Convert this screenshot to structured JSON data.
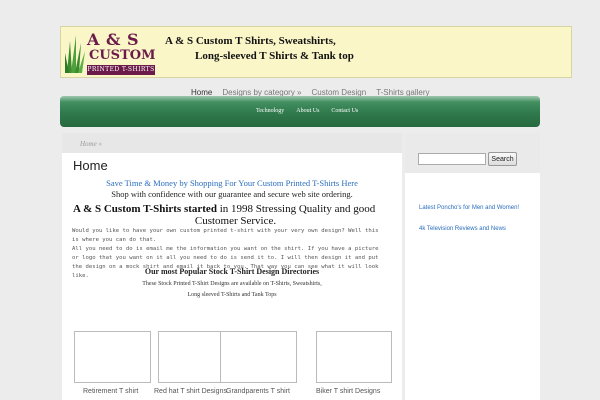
{
  "header": {
    "logo_main": "A & S",
    "logo_sub": "CUSTOM",
    "logo_bar": "PRINTED T-SHIRTS",
    "title_line1": "A & S Custom T Shirts, Sweatshirts,",
    "title_line2": "Long-sleeved T Shirts & Tank top"
  },
  "topnav": {
    "items": [
      "Home",
      "Designs by category »",
      "Custom Design",
      "T-Shirts gallery"
    ]
  },
  "subnav": {
    "items": [
      "Technology",
      "About Us",
      "Contact Us"
    ]
  },
  "main": {
    "breadcrumb": "Home »",
    "page_title": "Home",
    "save_line": "Save Time & Money by Shopping For Your Custom Printed T-Shirts Here",
    "ship_line": "Shop with confidence with our guarantee and secure web site ordering.",
    "started_bold": "A & S Custom T-Shirts started",
    "started_rest": " in 1998  Stressing Quality and good",
    "started_line2": "Customer Service.",
    "body_lines": [
      "Would you like to have your own custom printed t-shirt with your very own design? Well this",
      "is where you can do that.",
      "All you need to do is email me the information you want on the shirt. If you have a picture",
      "or logo that you want on it all you need to do is send it to. I will then design it and put",
      "the design on a mock shirt and email it back to you. That way you can see what it will look",
      "like."
    ],
    "directories_title": "Our most Popular Stock T-Shirt Design Directories",
    "dir_sub_line1": "These Stock Printed T-Shirt Designs are available on T-Shirts, Sweatshirts,",
    "dir_sub_line2": "Long sleeved T-Shirts and Tank Tops",
    "thumbs": [
      {
        "label": "Retirement T shirt"
      },
      {
        "label": "Red hat T shirt Designs"
      },
      {
        "label": "Grandparents T shirt"
      },
      {
        "label": "Biker T shirt Designs"
      }
    ]
  },
  "sidebar": {
    "search_placeholder": "",
    "search_button": "Search",
    "links": [
      "Latest Poncho's for Men and Women!",
      "4k Television Reviews and News"
    ]
  },
  "colors": {
    "accent_green": "#2f7a4c",
    "link_blue": "#2a6ebd",
    "logo_maroon": "#6b1a4a",
    "banner_bg": "#faf6c8"
  }
}
